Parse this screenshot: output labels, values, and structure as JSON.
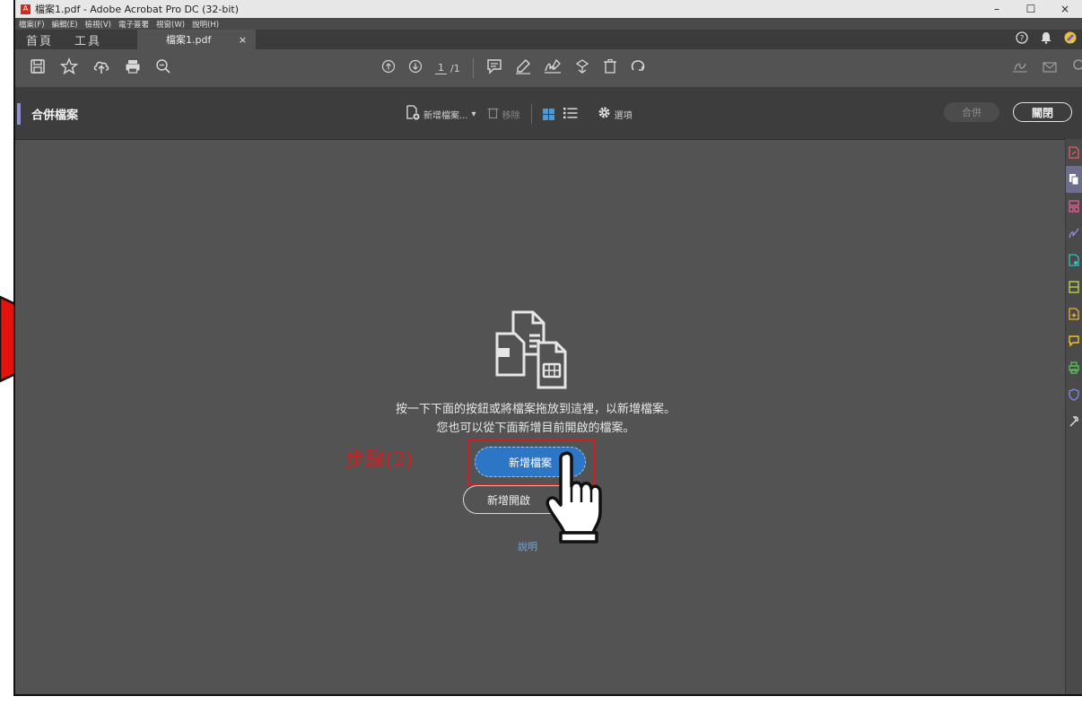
{
  "window": {
    "title": "檔案1.pdf - Adobe Acrobat Pro DC (32-bit)",
    "app_icon": "acrobat-icon",
    "minimize": "–",
    "maximize": "☐",
    "close": "×"
  },
  "menu": [
    "檔案(F)",
    "編輯(E)",
    "檢視(V)",
    "電子簽署",
    "視窗(W)",
    "說明(H)"
  ],
  "tabs": {
    "home": "首頁",
    "tools": "工具",
    "document": "檔案1.pdf",
    "document_close": "×"
  },
  "toolbar": {
    "page_current": "1",
    "page_total": "/1"
  },
  "combine": {
    "title": "合併檔案",
    "add_files": "新增檔案...",
    "add_caret": "▾",
    "remove": "移除",
    "options": "選項",
    "combine_button": "合併",
    "close_button": "關閉"
  },
  "main": {
    "instruction_line1": "按一下下面的按鈕或將檔案拖放到這裡，以新增檔案。",
    "instruction_line2": "您也可以從下面新增目前開啟的檔案。",
    "add_files_button": "新增檔案",
    "add_open_files_button": "新增開啟",
    "help_link": "說明"
  },
  "annotation": {
    "step_label": "步驟(2)",
    "color": "#d21f1f"
  },
  "colors": {
    "accent": "#2d76c6",
    "panel_accent": "#8f8fd6",
    "red": "#d21f1f"
  },
  "right_panel_icons": [
    {
      "name": "export-pdf-icon",
      "color": "#e85d5d"
    },
    {
      "name": "combine-files-icon",
      "color": "#ffffff"
    },
    {
      "name": "organize-pages-icon",
      "color": "#e85d9a"
    },
    {
      "name": "fill-sign-icon",
      "color": "#a48ad8"
    },
    {
      "name": "edit-pdf-icon",
      "color": "#2fc0c0"
    },
    {
      "name": "scan-ocr-icon",
      "color": "#c8d845"
    },
    {
      "name": "create-pdf-icon",
      "color": "#f0b030"
    },
    {
      "name": "comment-icon",
      "color": "#f2c318"
    },
    {
      "name": "print-production-icon",
      "color": "#54c454"
    },
    {
      "name": "protect-icon",
      "color": "#7a8ae8"
    },
    {
      "name": "more-tools-icon",
      "color": "#d8d8d8"
    }
  ]
}
